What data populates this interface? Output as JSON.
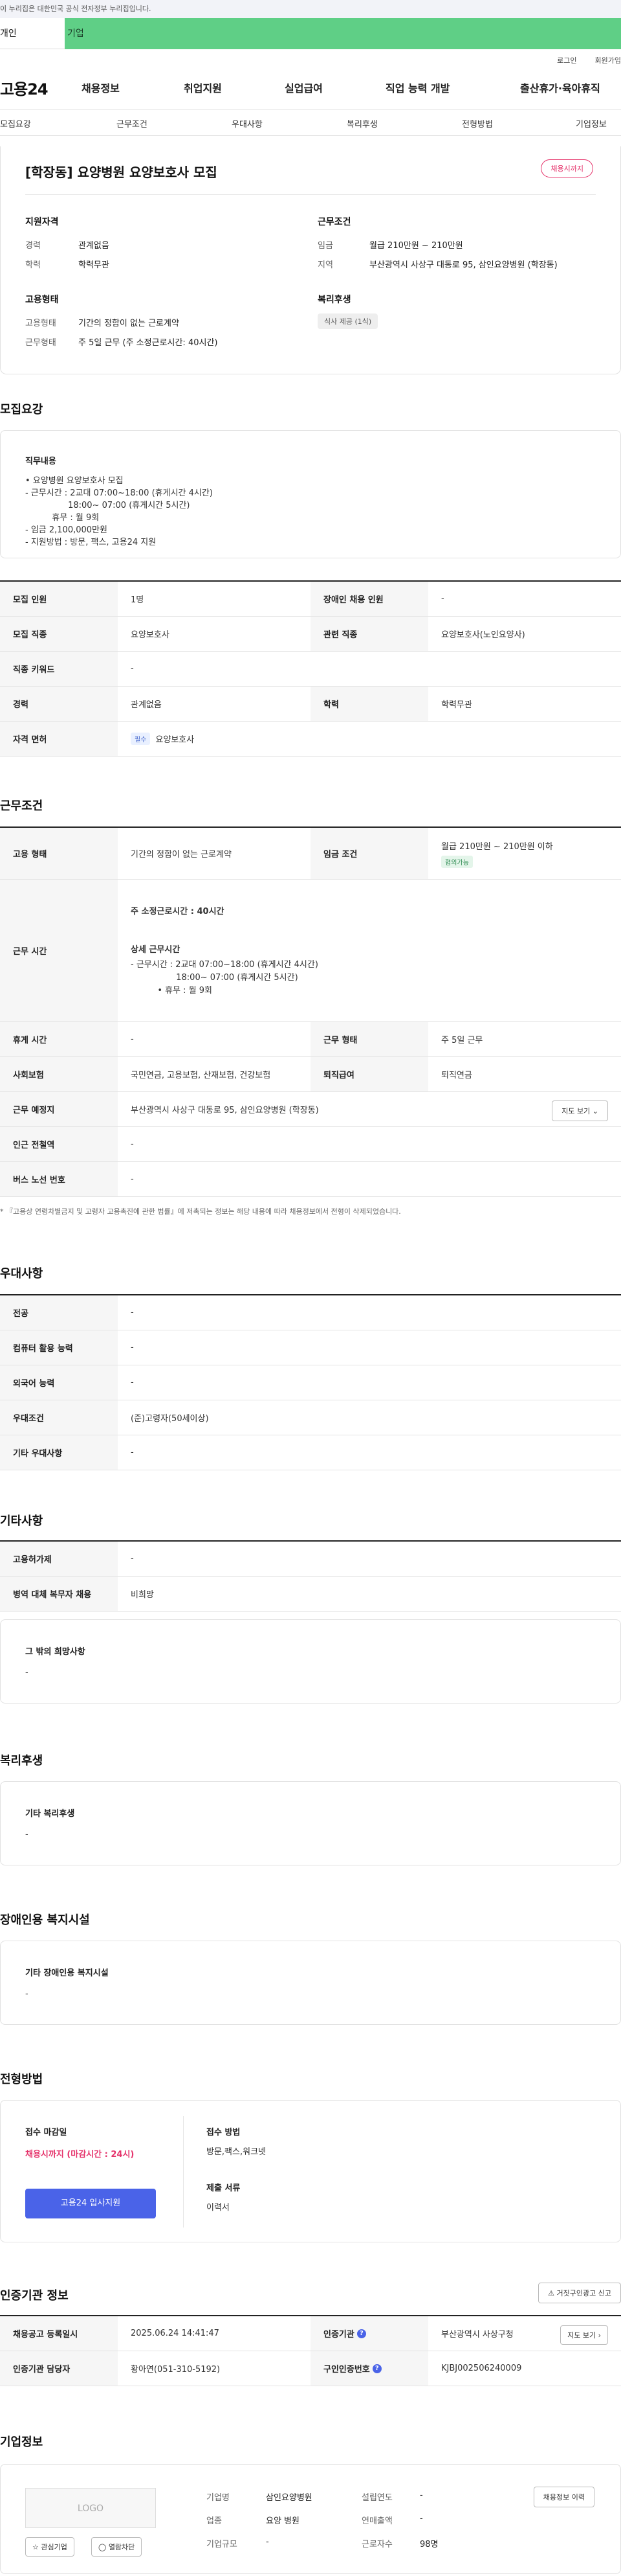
{
  "gov_strip": "이 누리집은 대한민국 공식 전자정부 누리집입니다.",
  "tabs": {
    "person": "개인",
    "corp": "기업"
  },
  "util": {
    "login": "로그인",
    "signup": "회원가입"
  },
  "logo": "고용24",
  "gnb": [
    "채용정보",
    "취업지원",
    "실업급여",
    "직업 능력 개발",
    "출산휴가·육아휴직"
  ],
  "sub_tabs": [
    "모집요강",
    "근무조건",
    "우대사항",
    "복리후생",
    "전형방법",
    "기업정보"
  ],
  "title_card": {
    "title": "[학장동] 요양병원 요양보호사 모집",
    "badge": "채용시까지",
    "qual_heading": "지원자격",
    "career_k": "경력",
    "career_v": "관계없음",
    "edu_k": "학력",
    "edu_v": "학력무관",
    "cond_heading": "근무조건",
    "wage_k": "임금",
    "wage_v": "월급 210만원 ~ 210만원",
    "region_k": "지역",
    "region_v": "부산광역시 사상구 대동로 95, 삼인요양병원 (학장동)",
    "emp_heading": "고용형태",
    "emptype_k": "고용형태",
    "emptype_v": "기간의 정함이 없는 근로계약",
    "worktype_k": "근무형태",
    "worktype_v": "주 5일 근무 (주 소정근로시간: 40시간)",
    "welfare_heading": "복리후생",
    "welfare_chip": "식사 제공 (1식)"
  },
  "recruit": {
    "section_title": "모집요강",
    "duty_title": "직무내용",
    "duty_text": "• 요양병원 요양보호사 모집\n- 근무시간 : 2교대 07:00~18:00 (휴게시간 4시간)\n                18:00~ 07:00 (휴게시간 5시간)\n          휴무 : 월 9회\n- 임금 2,100,000만원\n- 지원방법 : 방문, 팩스, 고용24 지원",
    "rows": {
      "headcount_k": "모집 인원",
      "headcount_v": "1명",
      "disabled_k": "장애인 채용 인원",
      "disabled_v": "-",
      "job_k": "모집 직종",
      "job_v": "요양보호사",
      "related_k": "관련 직종",
      "related_v": "요양보호사(노인요양사)",
      "keyword_k": "직종 키워드",
      "keyword_v": "-",
      "career_k": "경력",
      "career_v": "관계없음",
      "edu_k": "학력",
      "edu_v": "학력무관",
      "license_k": "자격 면허",
      "license_chip": "필수",
      "license_v": "요양보호사"
    }
  },
  "conditions": {
    "section_title": "근무조건",
    "emptype_k": "고용 형태",
    "emptype_v": "기간의 정함이 없는 근로계약",
    "wage_k": "임금 조건",
    "wage_v": "월급 210만원 ~ 210만원 이하",
    "wage_chip": "협의가능",
    "hours_k": "근무 시간",
    "hours_main": "주 소정근로시간 : 40시간",
    "hours_detail_title": "상세 근무시간",
    "hours_detail": "- 근무시간 : 2교대 07:00~18:00 (휴게시간 4시간)\n                 18:00~ 07:00 (휴게시간 5시간)\n          • 휴무 : 월 9회",
    "break_k": "휴게 시간",
    "break_v": "-",
    "worktype_k": "근무 형태",
    "worktype_v": "주 5일 근무",
    "insurance_k": "사회보험",
    "insurance_v": "국민연금, 고용보험, 산재보험, 건강보험",
    "retire_k": "퇴직급여",
    "retire_v": "퇴직연금",
    "place_k": "근무 예정지",
    "place_v": "부산광역시 사상구 대동로 95, 삼인요양병원 (학장동)",
    "map_btn": "지도 보기",
    "subway_k": "인근 전철역",
    "subway_v": "-",
    "bus_k": "버스 노선 번호",
    "bus_v": "-",
    "note": "* 『고용상 연령차별금지 및 고령자 고용촉진에 관한 법률』에 저촉되는 정보는 해당 내용에 따라 채용정보에서 전형이 삭제되었습니다."
  },
  "preference": {
    "section_title": "우대사항",
    "major_k": "전공",
    "major_v": "-",
    "computer_k": "컴퓨터 활용 능력",
    "computer_v": "-",
    "lang_k": "외국어 능력",
    "lang_v": "-",
    "pref_k": "우대조건",
    "pref_v": "(준)고령자(50세이상)",
    "other_k": "기타 우대사항",
    "other_v": "-"
  },
  "etc": {
    "section_title": "기타사항",
    "permit_k": "고용허가제",
    "permit_v": "-",
    "military_k": "병역 대체 복무자 채용",
    "military_v": "비희망",
    "wish_title": "그 밖의 희망사항",
    "wish_v": "-"
  },
  "welfare": {
    "section_title": "복리후생",
    "box_title": "기타 복리후생",
    "box_v": "-"
  },
  "disability": {
    "section_title": "장애인용 복지시설",
    "box_title": "기타 장애인용 복지시설",
    "box_v": "-"
  },
  "process": {
    "section_title": "전형방법",
    "deadline_title": "접수 마감일",
    "deadline_v": "채용시까지 (마감시간 : 24시)",
    "apply_btn": "고용24 입사지원",
    "method_title": "접수 방법",
    "method_v": "방문,팩스,워크넷",
    "docs_title": "제출 서류",
    "docs_v": "이력서"
  },
  "agency": {
    "section_title": "인증기관 정보",
    "report_btn": "거짓구인광고 신고",
    "reg_k": "채용공고 등록일시",
    "reg_v": "2025.06.24 14:41:47",
    "org_k": "인증기관",
    "org_v": "부산광역시 사상구청",
    "org_btn": "지도 보기",
    "manager_k": "인증기관 담당자",
    "manager_v": "황아연(051-310-5192)",
    "auth_k": "구인인증번호",
    "auth_v": "KJBJ002506240009"
  },
  "company": {
    "section_title": "기업정보",
    "logo_text": "LOGO",
    "interest_btn": "관심기업",
    "block_btn": "열람차단",
    "name_k": "기업명",
    "name_v": "삼인요양병원",
    "industry_k": "업종",
    "industry_v": "요양 병원",
    "size_k": "기업규모",
    "size_v": "-",
    "founded_k": "설립연도",
    "founded_v": "-",
    "sales_k": "연매출액",
    "sales_v": "-",
    "employees_k": "근로자수",
    "employees_v": "98명",
    "history_btn": "채용정보 이력"
  },
  "colors": {
    "accent": "#4a63e8",
    "corp_tab": "#5fcf86",
    "deadline": "#e5336b"
  }
}
